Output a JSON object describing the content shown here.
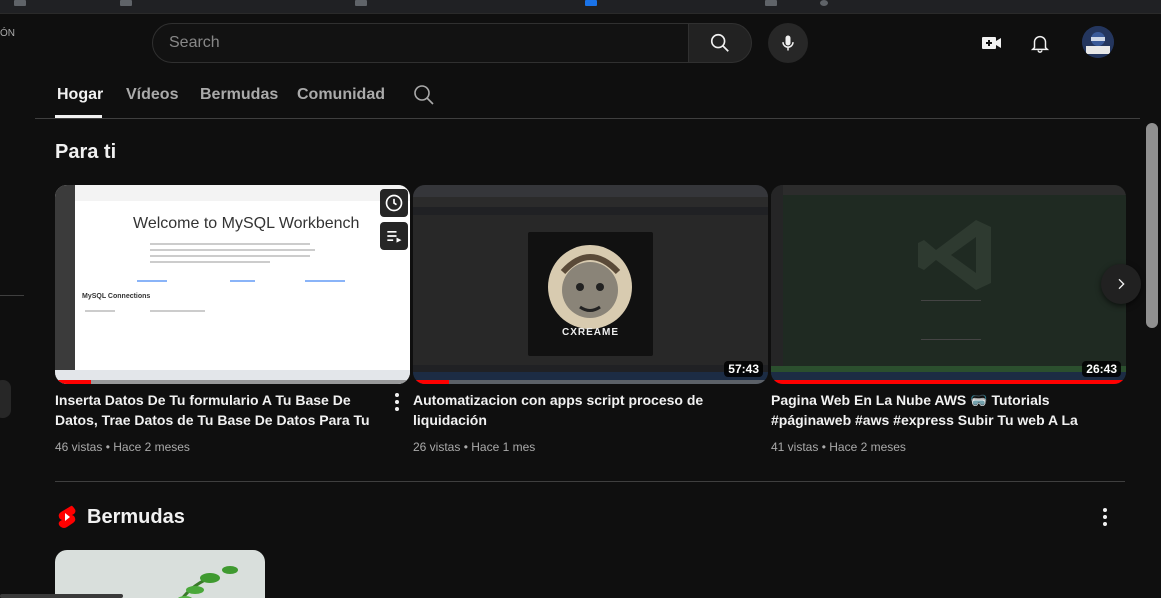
{
  "header": {
    "search_placeholder": "Search",
    "icons": [
      "search-icon",
      "mic-icon",
      "create-video-icon",
      "notifications-bell-icon",
      "avatar"
    ]
  },
  "left_fragment": {
    "text": "ÓN"
  },
  "channel_tabs": [
    {
      "label": "Hogar",
      "active": true
    },
    {
      "label": "Vídeos",
      "active": false
    },
    {
      "label": "Bermudas",
      "active": false
    },
    {
      "label": "Comunidad",
      "active": false
    }
  ],
  "for_you": {
    "title": "Para ti",
    "videos": [
      {
        "title": "Inserta Datos De Tu formulario A Tu Base De Datos, Trae Datos de Tu Base De Datos Para Tu PaginaWeb",
        "views": "46 vistas",
        "age": "Hace 2 meses",
        "duration": "",
        "watched_fraction": 0.1,
        "thumb_text": "Welcome to MySQL Workbench",
        "thumb_subtext": "MySQL Connections"
      },
      {
        "title": "Automatizacion con apps script proceso de liquidación",
        "views": "26 vistas",
        "age": "Hace 1 mes",
        "duration": "57:43",
        "watched_fraction": 0.1,
        "thumb_text": "CXREAME"
      },
      {
        "title": "Pagina Web En La Nube AWS 🥽 Tutorials #páginaweb #aws #express Subir Tu web A La Nub…",
        "views": "41 vistas",
        "age": "Hace 2 meses",
        "duration": "26:43",
        "watched_fraction": 1.0
      }
    ]
  },
  "shorts_section": {
    "title": "Bermudas"
  },
  "colors": {
    "background": "#0f0f0f",
    "accent_red": "#ff0000",
    "text_primary": "#f1f1f1",
    "text_secondary": "#aaaaaa"
  }
}
